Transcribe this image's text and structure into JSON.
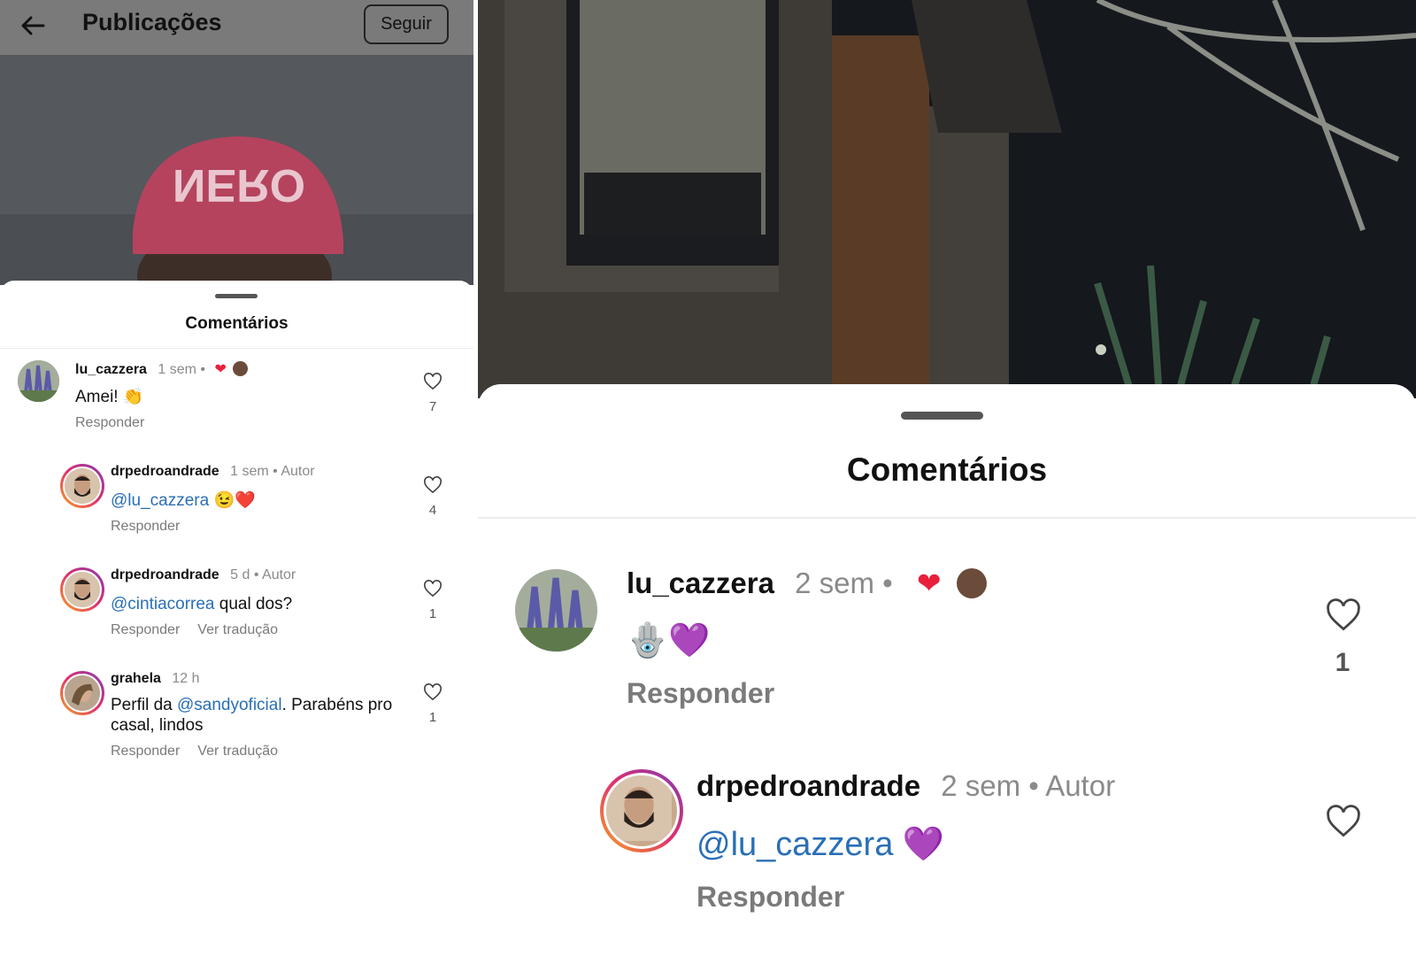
{
  "left": {
    "header": {
      "title": "Publicações",
      "follow_label": "Seguir",
      "cap_text": "NERO"
    },
    "sheet_title": "Comentários",
    "comments": [
      {
        "user": "lu_cazzera",
        "time": "1 sem",
        "dot": "•",
        "text": "Amei! 👏",
        "actions": [
          "Responder"
        ],
        "likes": "7"
      },
      {
        "user": "drpedroandrade",
        "time": "1 sem",
        "dot": "•",
        "author": "Autor",
        "mention": "@lu_cazzera",
        "text": " 😉❤️",
        "actions": [
          "Responder"
        ],
        "likes": "4"
      },
      {
        "user": "drpedroandrade",
        "time": "5 d",
        "dot": "•",
        "author": "Autor",
        "mention": "@cintiacorrea",
        "text": " qual dos?",
        "actions": [
          "Responder",
          "Ver tradução"
        ],
        "likes": "1"
      },
      {
        "user": "grahela",
        "time": "12 h",
        "text_before": "Perfil da ",
        "mention": "@sandyoficial",
        "text": ". Parabéns pro casal, lindos",
        "actions": [
          "Responder",
          "Ver tradução"
        ],
        "likes": "1"
      }
    ]
  },
  "right": {
    "sheet_title": "Comentários",
    "comments": [
      {
        "user": "lu_cazzera",
        "time": "2 sem",
        "dot": "•",
        "text": "🪬💜",
        "actions": [
          "Responder"
        ],
        "likes": "1"
      },
      {
        "user": "drpedroandrade",
        "time": "2 sem",
        "dot": "•",
        "author": "Autor",
        "mention": "@lu_cazzera",
        "text": " 💜",
        "actions": [
          "Responder"
        ]
      }
    ]
  },
  "colors": {
    "mention": "#2a6fb6",
    "heart_reaction": "#e8203a",
    "muted": "#8a8a8a"
  },
  "icons": [
    "back-arrow-icon",
    "heart-outline-icon",
    "heart-filled-icon",
    "drag-handle"
  ]
}
